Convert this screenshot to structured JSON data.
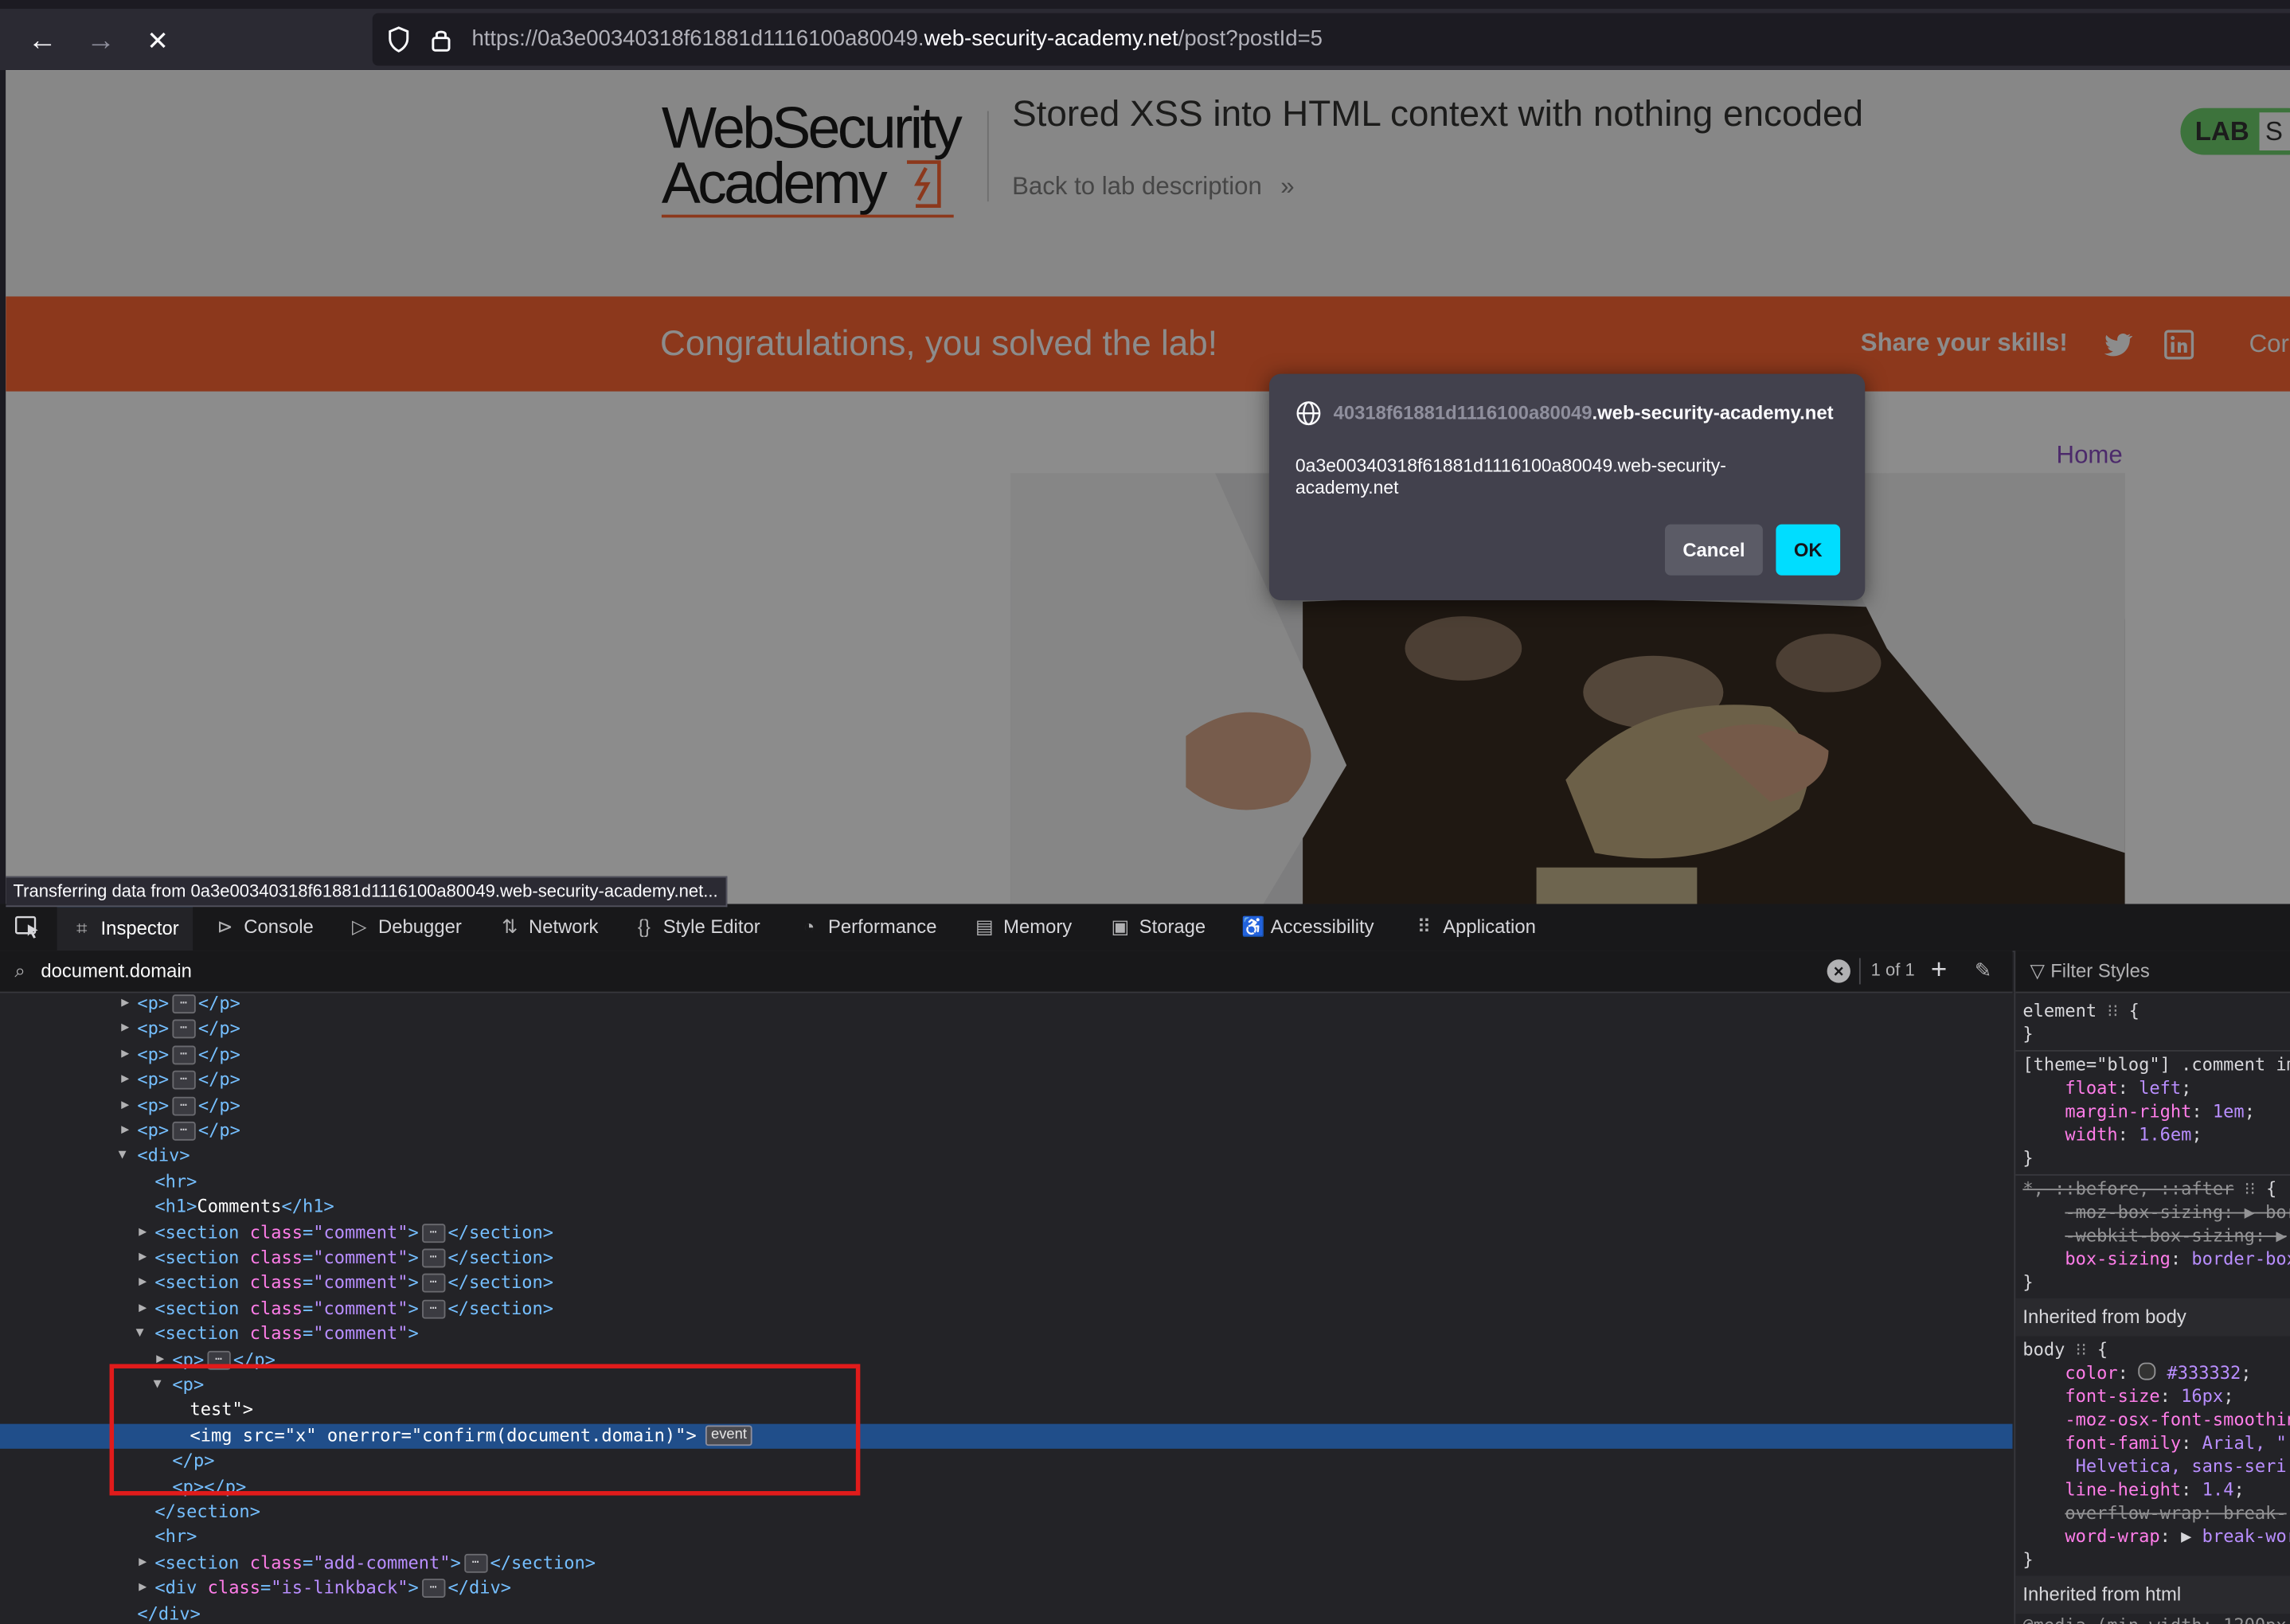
{
  "browser": {
    "url_prefix": "https://0a3e00340318f61881d1116100a80049.",
    "url_host": "web-security-academy.net",
    "url_path": "/post?postId=5",
    "back_label": "←",
    "forward_label": "→",
    "stop_label": "✕"
  },
  "page": {
    "logo_line1": "WebSecurity",
    "logo_line2": "Academy",
    "lab_title": "Stored XSS into HTML context with nothing encoded",
    "back_link": "Back to lab description",
    "lab_badge": "LAB",
    "lab_badge_status": "S",
    "solved_message": "Congratulations, you solved the lab!",
    "share_label": "Share your skills!",
    "continue_partial": "Cor",
    "home_link": "Home",
    "status_text": "Transferring data from 0a3e00340318f61881d1116100a80049.web-security-academy.net..."
  },
  "dialog": {
    "origin_faded": "40318f61881d1116100a80049",
    "origin_main": ".web-security-academy.net",
    "message": "0a3e00340318f61881d1116100a80049.web-security-academy.net",
    "cancel_label": "Cancel",
    "ok_label": "OK"
  },
  "devtools": {
    "tabs": [
      {
        "label": "Inspector",
        "icon": "inspector-icon"
      },
      {
        "label": "Console",
        "icon": "console-icon"
      },
      {
        "label": "Debugger",
        "icon": "debugger-icon"
      },
      {
        "label": "Network",
        "icon": "network-icon"
      },
      {
        "label": "Style Editor",
        "icon": "style-editor-icon"
      },
      {
        "label": "Performance",
        "icon": "performance-icon"
      },
      {
        "label": "Memory",
        "icon": "memory-icon"
      },
      {
        "label": "Storage",
        "icon": "storage-icon"
      },
      {
        "label": "Accessibility",
        "icon": "accessibility-icon"
      },
      {
        "label": "Application",
        "icon": "application-icon"
      }
    ],
    "search_value": "document.domain",
    "search_count": "1 of 1",
    "markup": {
      "comments_heading": "Comments",
      "comment_text": "test\">",
      "img_src": "x",
      "img_onerror": "confirm(document.domain)",
      "event_badge": "event",
      "class_comment": "comment",
      "class_add_comment": "add-comment",
      "class_linkback": "is-linkback"
    },
    "rules": {
      "filter_placeholder": "Filter Styles",
      "inherited_body": "Inherited from body",
      "inherited_html": "Inherited from html",
      "body_color": "#333332",
      "body_font_size": "16px",
      "media_query": "@media (min-width: 1200px"
    }
  }
}
